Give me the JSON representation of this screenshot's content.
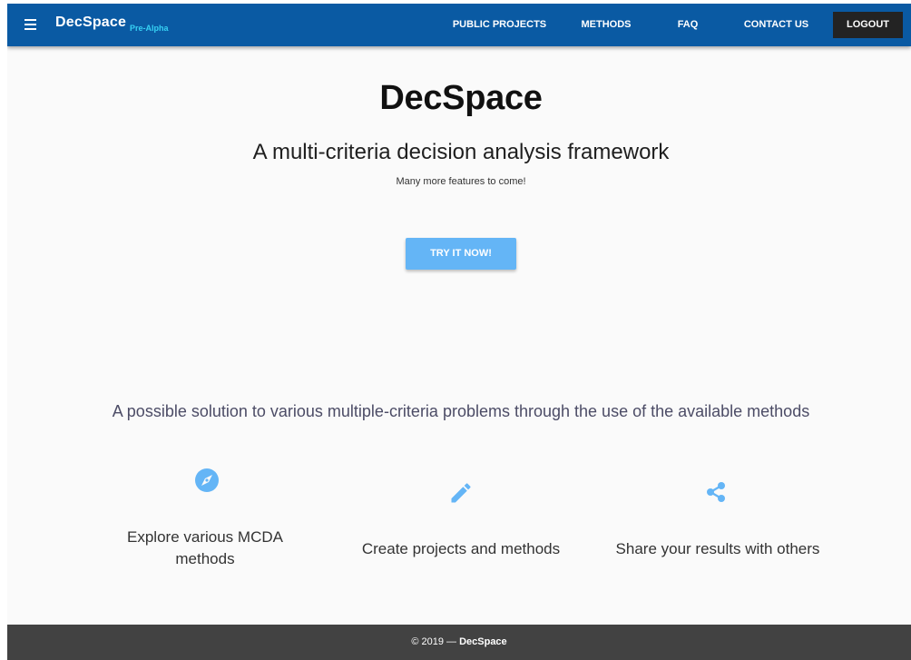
{
  "header": {
    "brand": "DecSpace",
    "brand_tag": "Pre-Alpha",
    "nav": {
      "public_projects": "PUBLIC PROJECTS",
      "methods": "METHODS",
      "faq": "FAQ",
      "contact_us": "CONTACT US",
      "logout": "LOGOUT"
    },
    "menu_icon": "hamburger-menu-icon"
  },
  "hero": {
    "title": "DecSpace",
    "subtitle": "A multi-criteria decision analysis framework",
    "note": "Many more features to come!",
    "cta": "TRY IT NOW!"
  },
  "features": {
    "heading": "A possible solution to various multiple-criteria problems through the use of the available methods",
    "items": [
      {
        "icon": "compass-icon",
        "label": "Explore various MCDA methods"
      },
      {
        "icon": "pencil-icon",
        "label": "Create projects and methods"
      },
      {
        "icon": "share-icon",
        "label": "Share your results with others"
      }
    ]
  },
  "footer": {
    "copyright": "© 2019 —",
    "brand": "DecSpace"
  },
  "colors": {
    "toolbar": "#0a5aa3",
    "accent": "#64b5f6",
    "brand_tag": "#36d1f4",
    "logout_bg": "#232323",
    "footer_bg": "#424242",
    "background": "#fafafa"
  }
}
